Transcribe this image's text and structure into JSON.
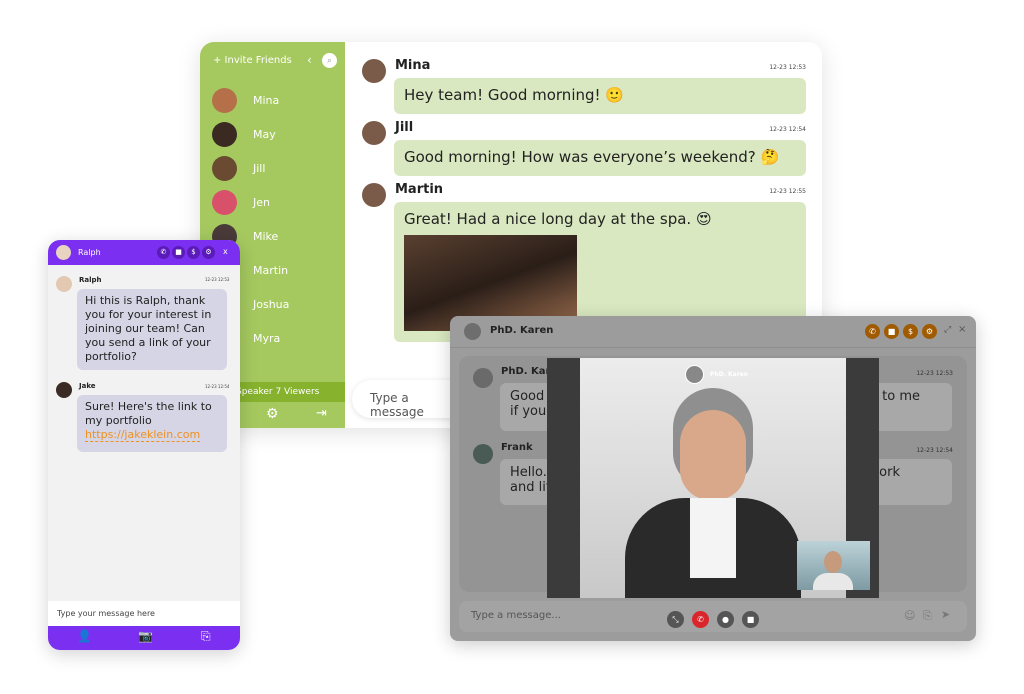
{
  "main_window": {
    "sidebar": {
      "invite_label": "+ Invite Friends",
      "contacts": [
        {
          "name": "Mina",
          "avatar_color": "#b5704a"
        },
        {
          "name": "May",
          "avatar_color": "#3a2a22"
        },
        {
          "name": "Jill",
          "avatar_color": "#6a4a30"
        },
        {
          "name": "Jen",
          "avatar_color": "#d8506a"
        },
        {
          "name": "Mike",
          "avatar_color": "#4a3a3a"
        },
        {
          "name": "Martin",
          "avatar_color": ""
        },
        {
          "name": "Joshua",
          "avatar_color": ""
        },
        {
          "name": "Myra",
          "avatar_color": ""
        }
      ],
      "speaker_label": "Speaker 7 Viewers"
    },
    "messages": [
      {
        "name": "Mina",
        "time": "12-23 12:53",
        "text": "Hey team! Good morning!",
        "emoji": "🙂"
      },
      {
        "name": "Jill",
        "time": "12-23 12:54",
        "text": "Good morning! How was everyone’s weekend?",
        "emoji": "🤔"
      },
      {
        "name": "Martin",
        "time": "12-23 12:55",
        "text": "Great! Had a nice long day at the spa.",
        "emoji": "😍"
      }
    ],
    "input_placeholder": "Type a message"
  },
  "mobile": {
    "header_name": "Ralph",
    "messages": [
      {
        "name": "Ralph",
        "time": "12-23 12:53",
        "text": "Hi this is Ralph, thank you for your interest in joining our team! Can you send a link of your portfolio?"
      },
      {
        "name": "Jake",
        "time": "12-23 12:54",
        "text": "Sure! Here's the link to my portfolio",
        "link": "https://jakeklein.com"
      }
    ],
    "input_placeholder": "Type your message here",
    "accent": "#7b2ff0"
  },
  "video_window": {
    "header_name": "PhD. Karen",
    "messages": [
      {
        "name": "PhD. Karen",
        "time": "12-23 12:53",
        "text_left": "Good\nif you",
        "text_right": "alk to me"
      },
      {
        "name": "Frank",
        "time": "12-23 12:54",
        "text_left": "Hello.\nand lif",
        "text_right": "work"
      }
    ],
    "call_label": "PhD. Karen",
    "input_placeholder": "Type a message...",
    "accent": "#a05a00"
  }
}
